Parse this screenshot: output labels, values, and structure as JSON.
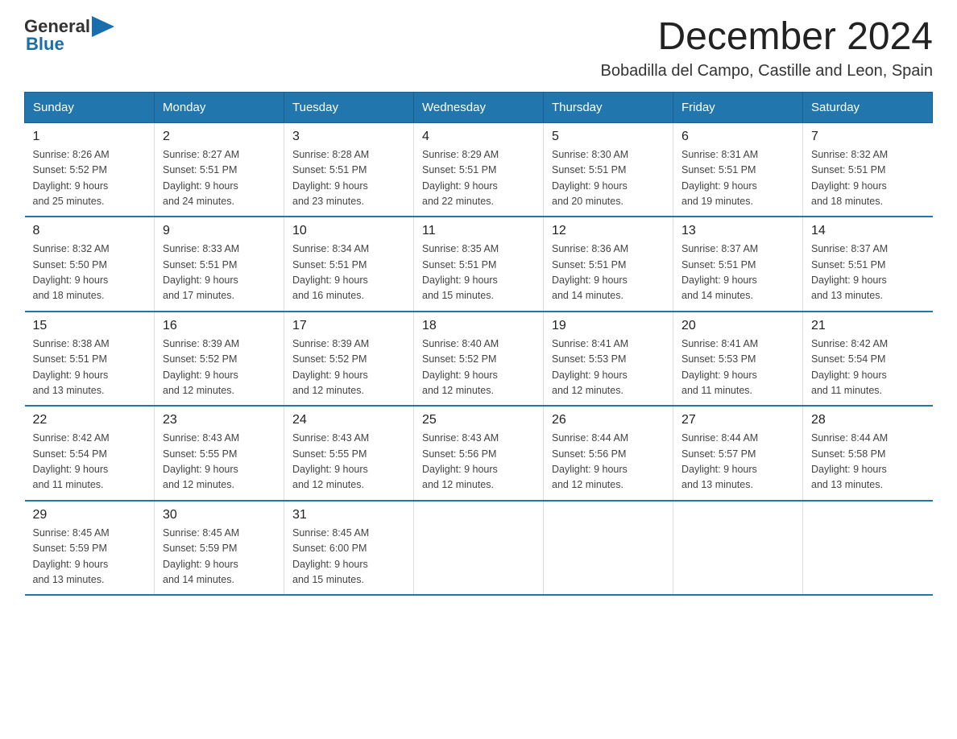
{
  "header": {
    "logo_general": "General",
    "logo_blue": "Blue",
    "title": "December 2024",
    "subtitle": "Bobadilla del Campo, Castille and Leon, Spain"
  },
  "days_of_week": [
    "Sunday",
    "Monday",
    "Tuesday",
    "Wednesday",
    "Thursday",
    "Friday",
    "Saturday"
  ],
  "weeks": [
    [
      {
        "day": "1",
        "sunrise": "8:26 AM",
        "sunset": "5:52 PM",
        "daylight": "9 hours and 25 minutes."
      },
      {
        "day": "2",
        "sunrise": "8:27 AM",
        "sunset": "5:51 PM",
        "daylight": "9 hours and 24 minutes."
      },
      {
        "day": "3",
        "sunrise": "8:28 AM",
        "sunset": "5:51 PM",
        "daylight": "9 hours and 23 minutes."
      },
      {
        "day": "4",
        "sunrise": "8:29 AM",
        "sunset": "5:51 PM",
        "daylight": "9 hours and 22 minutes."
      },
      {
        "day": "5",
        "sunrise": "8:30 AM",
        "sunset": "5:51 PM",
        "daylight": "9 hours and 20 minutes."
      },
      {
        "day": "6",
        "sunrise": "8:31 AM",
        "sunset": "5:51 PM",
        "daylight": "9 hours and 19 minutes."
      },
      {
        "day": "7",
        "sunrise": "8:32 AM",
        "sunset": "5:51 PM",
        "daylight": "9 hours and 18 minutes."
      }
    ],
    [
      {
        "day": "8",
        "sunrise": "8:32 AM",
        "sunset": "5:50 PM",
        "daylight": "9 hours and 18 minutes."
      },
      {
        "day": "9",
        "sunrise": "8:33 AM",
        "sunset": "5:51 PM",
        "daylight": "9 hours and 17 minutes."
      },
      {
        "day": "10",
        "sunrise": "8:34 AM",
        "sunset": "5:51 PM",
        "daylight": "9 hours and 16 minutes."
      },
      {
        "day": "11",
        "sunrise": "8:35 AM",
        "sunset": "5:51 PM",
        "daylight": "9 hours and 15 minutes."
      },
      {
        "day": "12",
        "sunrise": "8:36 AM",
        "sunset": "5:51 PM",
        "daylight": "9 hours and 14 minutes."
      },
      {
        "day": "13",
        "sunrise": "8:37 AM",
        "sunset": "5:51 PM",
        "daylight": "9 hours and 14 minutes."
      },
      {
        "day": "14",
        "sunrise": "8:37 AM",
        "sunset": "5:51 PM",
        "daylight": "9 hours and 13 minutes."
      }
    ],
    [
      {
        "day": "15",
        "sunrise": "8:38 AM",
        "sunset": "5:51 PM",
        "daylight": "9 hours and 13 minutes."
      },
      {
        "day": "16",
        "sunrise": "8:39 AM",
        "sunset": "5:52 PM",
        "daylight": "9 hours and 12 minutes."
      },
      {
        "day": "17",
        "sunrise": "8:39 AM",
        "sunset": "5:52 PM",
        "daylight": "9 hours and 12 minutes."
      },
      {
        "day": "18",
        "sunrise": "8:40 AM",
        "sunset": "5:52 PM",
        "daylight": "9 hours and 12 minutes."
      },
      {
        "day": "19",
        "sunrise": "8:41 AM",
        "sunset": "5:53 PM",
        "daylight": "9 hours and 12 minutes."
      },
      {
        "day": "20",
        "sunrise": "8:41 AM",
        "sunset": "5:53 PM",
        "daylight": "9 hours and 11 minutes."
      },
      {
        "day": "21",
        "sunrise": "8:42 AM",
        "sunset": "5:54 PM",
        "daylight": "9 hours and 11 minutes."
      }
    ],
    [
      {
        "day": "22",
        "sunrise": "8:42 AM",
        "sunset": "5:54 PM",
        "daylight": "9 hours and 11 minutes."
      },
      {
        "day": "23",
        "sunrise": "8:43 AM",
        "sunset": "5:55 PM",
        "daylight": "9 hours and 12 minutes."
      },
      {
        "day": "24",
        "sunrise": "8:43 AM",
        "sunset": "5:55 PM",
        "daylight": "9 hours and 12 minutes."
      },
      {
        "day": "25",
        "sunrise": "8:43 AM",
        "sunset": "5:56 PM",
        "daylight": "9 hours and 12 minutes."
      },
      {
        "day": "26",
        "sunrise": "8:44 AM",
        "sunset": "5:56 PM",
        "daylight": "9 hours and 12 minutes."
      },
      {
        "day": "27",
        "sunrise": "8:44 AM",
        "sunset": "5:57 PM",
        "daylight": "9 hours and 13 minutes."
      },
      {
        "day": "28",
        "sunrise": "8:44 AM",
        "sunset": "5:58 PM",
        "daylight": "9 hours and 13 minutes."
      }
    ],
    [
      {
        "day": "29",
        "sunrise": "8:45 AM",
        "sunset": "5:59 PM",
        "daylight": "9 hours and 13 minutes."
      },
      {
        "day": "30",
        "sunrise": "8:45 AM",
        "sunset": "5:59 PM",
        "daylight": "9 hours and 14 minutes."
      },
      {
        "day": "31",
        "sunrise": "8:45 AM",
        "sunset": "6:00 PM",
        "daylight": "9 hours and 15 minutes."
      },
      null,
      null,
      null,
      null
    ]
  ],
  "labels": {
    "sunrise_prefix": "Sunrise: ",
    "sunset_prefix": "Sunset: ",
    "daylight_prefix": "Daylight: "
  }
}
